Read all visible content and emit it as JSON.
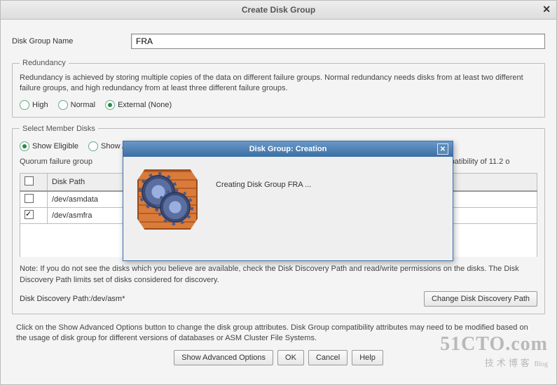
{
  "window": {
    "title": "Create Disk Group",
    "close_glyph": "✕"
  },
  "form": {
    "dgname_label": "Disk Group Name",
    "dgname_value": "FRA"
  },
  "redundancy": {
    "legend": "Redundancy",
    "desc": "Redundancy is achieved by storing multiple copies of the data on different failure groups. Normal redundancy needs disks from at least two different failure groups, and high redundancy from at least three different failure groups.",
    "options": [
      {
        "label": "High",
        "selected": false
      },
      {
        "label": "Normal",
        "selected": false
      },
      {
        "label": "External (None)",
        "selected": true
      }
    ]
  },
  "disks": {
    "legend": "Select Member Disks",
    "show_options": [
      {
        "label": "Show Eligible",
        "selected": true
      },
      {
        "label": "Show All",
        "selected": false
      }
    ],
    "quorum_desc_visible_prefix": "Quorum failure group",
    "quorum_desc_visible_suffix": "quire ASM compatibility of 11.2 o",
    "columns": {
      "chk": "",
      "path": "Disk Path"
    },
    "rows": [
      {
        "checked": false,
        "path": "/dev/asmdata"
      },
      {
        "checked": true,
        "path": "/dev/asmfra"
      }
    ],
    "note": "Note: If you do not see the disks which you believe are available, check the Disk Discovery Path and read/write permissions on the disks. The Disk Discovery Path limits set of disks considered for discovery.",
    "ddp_label": "Disk Discovery Path:/dev/asm*",
    "change_ddp_btn": "Change Disk Discovery Path"
  },
  "footer": {
    "note": "Click on the Show Advanced Options button to change the disk group attributes. Disk Group compatibility attributes may need to be modified based on the usage of disk group for different versions of databases or ASM Cluster File Systems.",
    "buttons": {
      "adv": "Show Advanced Options",
      "ok": "OK",
      "cancel": "Cancel",
      "help": "Help"
    }
  },
  "modal": {
    "title": "Disk Group: Creation",
    "close_glyph": "✕",
    "message": "Creating Disk Group FRA ..."
  },
  "watermark": {
    "big": "51CTO.com",
    "sub": "技术博客",
    "blog": "Blog"
  }
}
